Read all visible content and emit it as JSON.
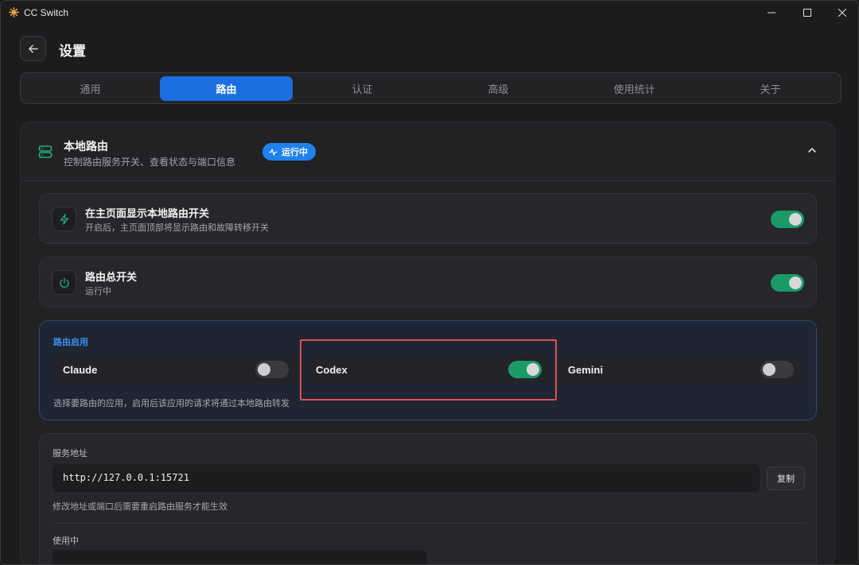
{
  "window": {
    "title": "CC Switch"
  },
  "header": {
    "title": "设置"
  },
  "tabs": [
    {
      "label": "通用",
      "active": false
    },
    {
      "label": "路由",
      "active": true
    },
    {
      "label": "认证",
      "active": false
    },
    {
      "label": "高级",
      "active": false
    },
    {
      "label": "使用统计",
      "active": false
    },
    {
      "label": "关于",
      "active": false
    }
  ],
  "local_routing": {
    "title": "本地路由",
    "subtitle": "控制路由服务开关、查看状态与端口信息",
    "status_badge": "运行中",
    "rows": [
      {
        "title": "在主页面显示本地路由开关",
        "desc": "开启后，主页面顶部将显示路由和故障转移开关",
        "icon": "lightning-icon",
        "enabled": true
      },
      {
        "title": "路由总开关",
        "desc": "运行中",
        "icon": "power-icon",
        "enabled": true
      }
    ],
    "apps": {
      "label": "路由启用",
      "items": [
        {
          "name": "Claude",
          "enabled": false
        },
        {
          "name": "Codex",
          "enabled": true
        },
        {
          "name": "Gemini",
          "enabled": false
        }
      ],
      "hint": "选择要路由的应用，启用后该应用的请求将通过本地路由转发"
    },
    "service": {
      "label": "服务地址",
      "address": "http://127.0.0.1:15721",
      "copy_label": "复制",
      "hint": "修改地址或端口后需要重启路由服务才能生效",
      "in_use_label": "使用中"
    }
  },
  "colors": {
    "accent": "#1a6ee0",
    "toggle_on": "#1a9a67",
    "highlight": "#e05050",
    "apps_label": "#3c8df0"
  }
}
